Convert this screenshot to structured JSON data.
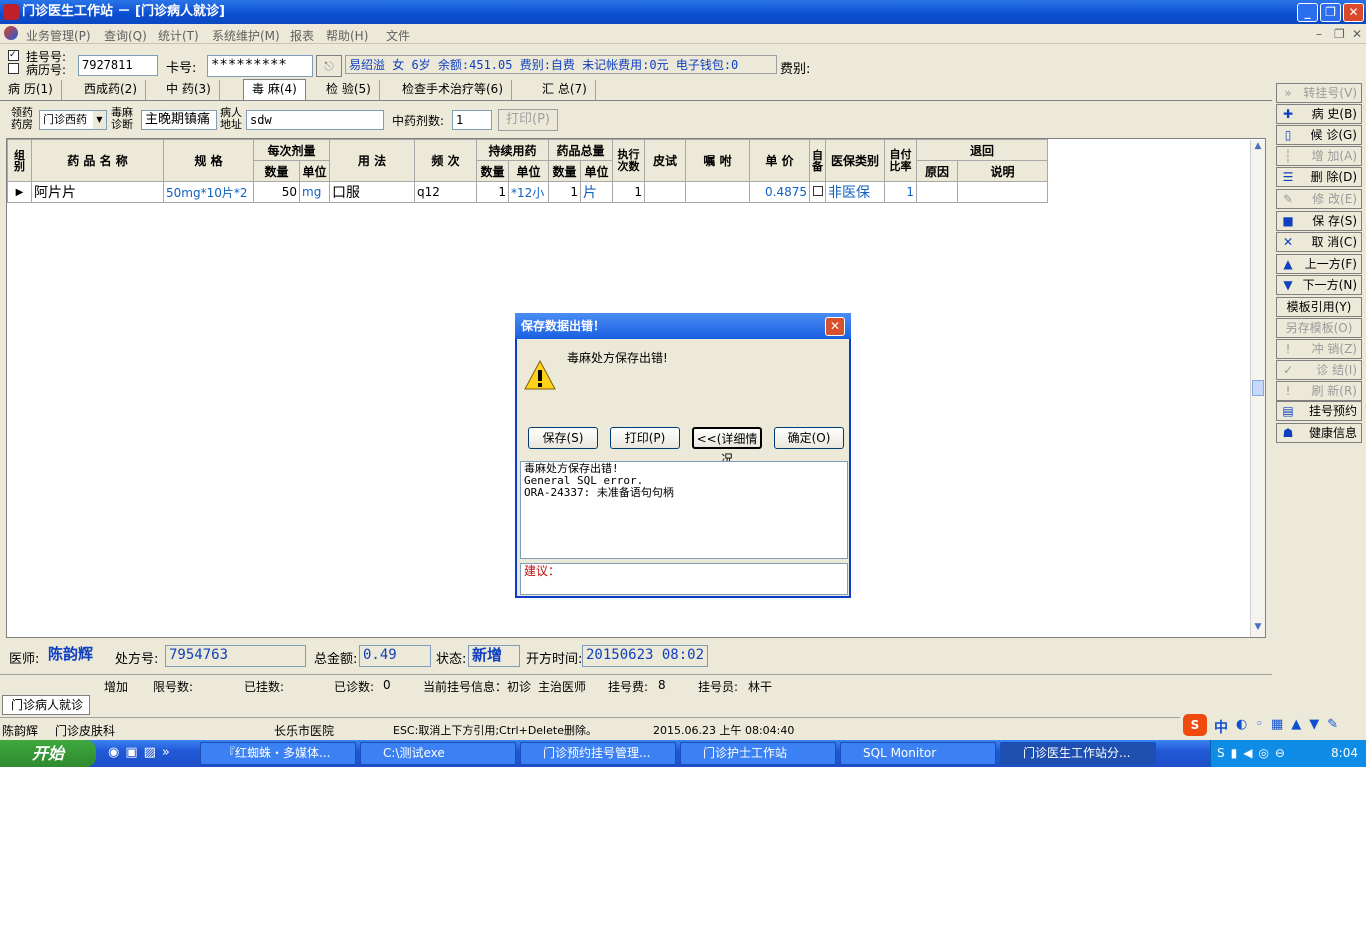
{
  "window": {
    "title": "门诊医生工作站 － [门诊病人就诊]",
    "min": "_",
    "max": "❐",
    "close": "✕"
  },
  "menu": [
    "业务管理(P)",
    "查询(Q)",
    "统计(T)",
    "系统维护(M)",
    "报表",
    "帮助(H)",
    "文件"
  ],
  "patient": {
    "reg_no_label": "挂号号:",
    "record_no_label": "病历号:",
    "record_no": "7927811",
    "card_label": "卡号:",
    "card": "*********",
    "info": "易绍溢 女 6岁 余额:451.05 费别:自费 未记帐费用:0元 电子钱包:0",
    "fee_label": "费别:"
  },
  "tabs": [
    "病 历(1)",
    "西成药(2)",
    "中 药(3)",
    "毒 麻(4)",
    "检 验(5)",
    "检查手术治疗等(6)",
    "汇 总(7)"
  ],
  "subbar": {
    "pharmacy_label": "领药药房",
    "pharmacy": "门诊西药",
    "diag_label": "毒麻诊断",
    "diag": "主晚期镇痛",
    "addr_label": "病人地址",
    "addr": "sdw",
    "herb_label": "中药剂数:",
    "herb": "1",
    "print": "打印(P)"
  },
  "table": {
    "headers": {
      "group": "组别",
      "name": "药 品 名 称",
      "spec": "规 格",
      "dose": "每次剂量",
      "dose_qty": "数量",
      "dose_unit": "单位",
      "usage": "用 法",
      "freq": "频 次",
      "cont": "持续用药",
      "cont_qty": "数量",
      "cont_unit": "单位",
      "total": "药品总量",
      "total_qty": "数量",
      "total_unit": "单位",
      "exec": "执行次数",
      "skin": "皮试",
      "note": "嘱 咐",
      "price": "单 价",
      "self": "自备",
      "ins": "医保类别",
      "ratio": "自付比率",
      "refund": "退回",
      "reason": "原因",
      "desc": "说明"
    },
    "rows": [
      {
        "marker": "▶",
        "name": "阿片片",
        "spec": "50mg*10片*2",
        "dose_qty": "50",
        "dose_unit": "mg",
        "usage": "口服",
        "freq": "q12",
        "cont_qty": "1",
        "cont_unit": "*12小",
        "total_qty": "1",
        "total_unit": "片",
        "exec": "1",
        "price": "0.4875",
        "ins": "非医保",
        "ratio": "1"
      }
    ]
  },
  "right_buttons": [
    {
      "label": "转挂号(V)",
      "icon": "»",
      "disabled": true
    },
    {
      "label": "病 史(B)",
      "icon": "✚",
      "disabled": false
    },
    {
      "label": "候 诊(G)",
      "icon": "▯",
      "disabled": false
    },
    {
      "label": "增 加(A)",
      "icon": "┆",
      "disabled": true
    },
    {
      "label": "删 除(D)",
      "icon": "☰",
      "disabled": false
    },
    {
      "label": "修 改(E)",
      "icon": "✎",
      "disabled": true
    },
    {
      "label": "保 存(S)",
      "icon": "■",
      "disabled": false
    },
    {
      "label": "取 消(C)",
      "icon": "✕",
      "disabled": false
    },
    {
      "label": "上一方(F)",
      "icon": "▲",
      "disabled": false
    },
    {
      "label": "下一方(N)",
      "icon": "▼",
      "disabled": false
    },
    {
      "label": "模板引用(Y)",
      "icon": "",
      "disabled": false
    },
    {
      "label": "另存模板(O)",
      "icon": "",
      "disabled": true
    },
    {
      "label": "冲 销(Z)",
      "icon": "!",
      "disabled": true
    },
    {
      "label": "诊 结(I)",
      "icon": "✓",
      "disabled": true
    },
    {
      "label": "刷 新(R)",
      "icon": "!",
      "disabled": true
    },
    {
      "label": "挂号预约",
      "icon": "▤",
      "disabled": false
    },
    {
      "label": "健康信息",
      "icon": "☗",
      "disabled": false
    }
  ],
  "bottom": {
    "doctor_label": "医师:",
    "doctor": "陈韵辉",
    "rx_label": "处方号:",
    "rx": "7954763",
    "total_label": "总金额:",
    "total": "0.49",
    "state_label": "状态:",
    "state": "新增",
    "time_label": "开方时间:",
    "time": "20150623 08:02"
  },
  "status1": {
    "add": "增加",
    "limit": "限号数:",
    "registered": "已挂数:",
    "visited": "已诊数:",
    "visited_n": "0",
    "cur": "当前挂号信息：初诊",
    "doc": "主治医师",
    "fee": "挂号费:",
    "fee_n": "8",
    "clerk": "挂号员:",
    "clerk_name": "林干"
  },
  "status_tab": "门诊病人就诊",
  "status2": {
    "user": "陈韵辉",
    "dept": "门诊皮肤科",
    "hospital": "长乐市医院",
    "hint": "ESC:取消上下方引用;Ctrl+Delete删除。",
    "datetime": "2015.06.23 上午 08:04:40"
  },
  "dialog": {
    "title": "保存数据出错！",
    "message": "毒麻处方保存出错!",
    "buttons": [
      "保存(S)",
      "打印(P)",
      "<<(详细情况",
      "确定(O)"
    ],
    "detail": [
      "毒麻处方保存出错!",
      "General SQL error.",
      "ORA-24337: 未准备语句句柄"
    ],
    "advice_label": "建议："
  },
  "taskbar": {
    "start": "开始",
    "items": [
      "『红蜘蛛・多媒体...",
      "C:\\测试exe",
      "门诊预约挂号管理...",
      "门诊护士工作站",
      "SQL Monitor",
      "门诊医生工作站分..."
    ],
    "clock": "8:04",
    "ime": "中"
  }
}
